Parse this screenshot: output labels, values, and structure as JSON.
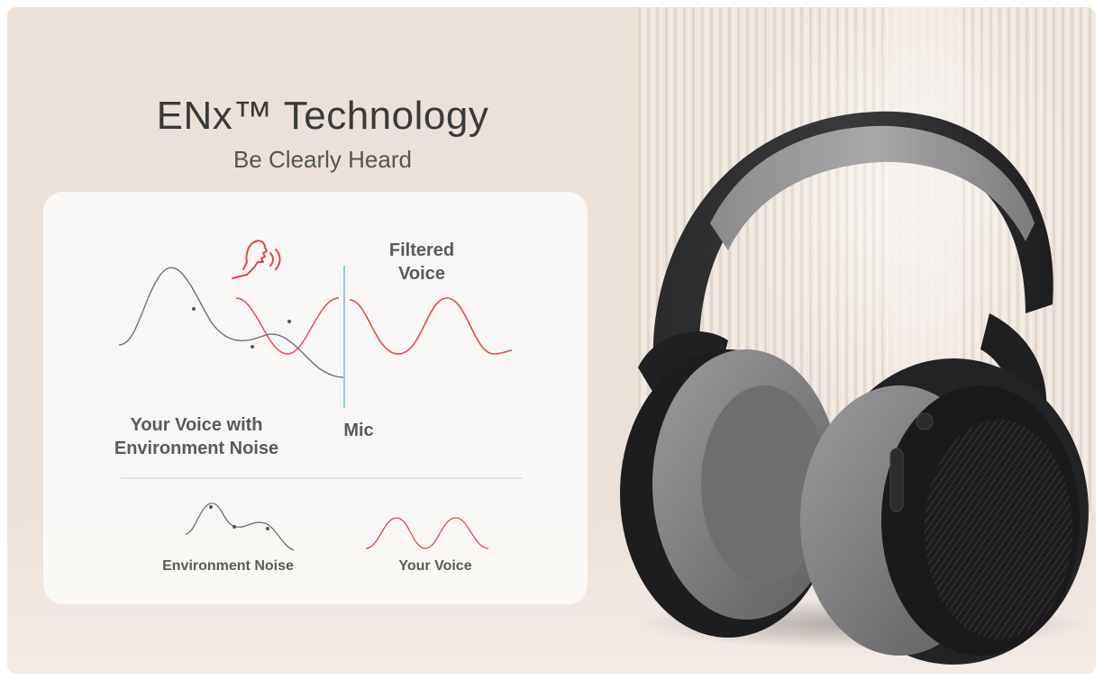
{
  "banner": {
    "title": "ENx™ Technology",
    "subtitle": "Be Clearly Heard"
  },
  "diagram": {
    "filtered_voice_label": "Filtered\nVoice",
    "voice_with_noise_label": "Your Voice with\nEnvironment Noise",
    "mic_label": "Mic",
    "legend": {
      "noise_label": "Environment Noise",
      "voice_label": "Your Voice"
    }
  },
  "colors": {
    "voice_wave": "#e0474a",
    "noise_wave": "#707070",
    "mic_line": "#8fc9e6",
    "card_bg": "#f9f8f6",
    "background": "#ede3da"
  },
  "icons": {
    "speaker": "speaking-head-icon",
    "product": "headphones-image"
  }
}
